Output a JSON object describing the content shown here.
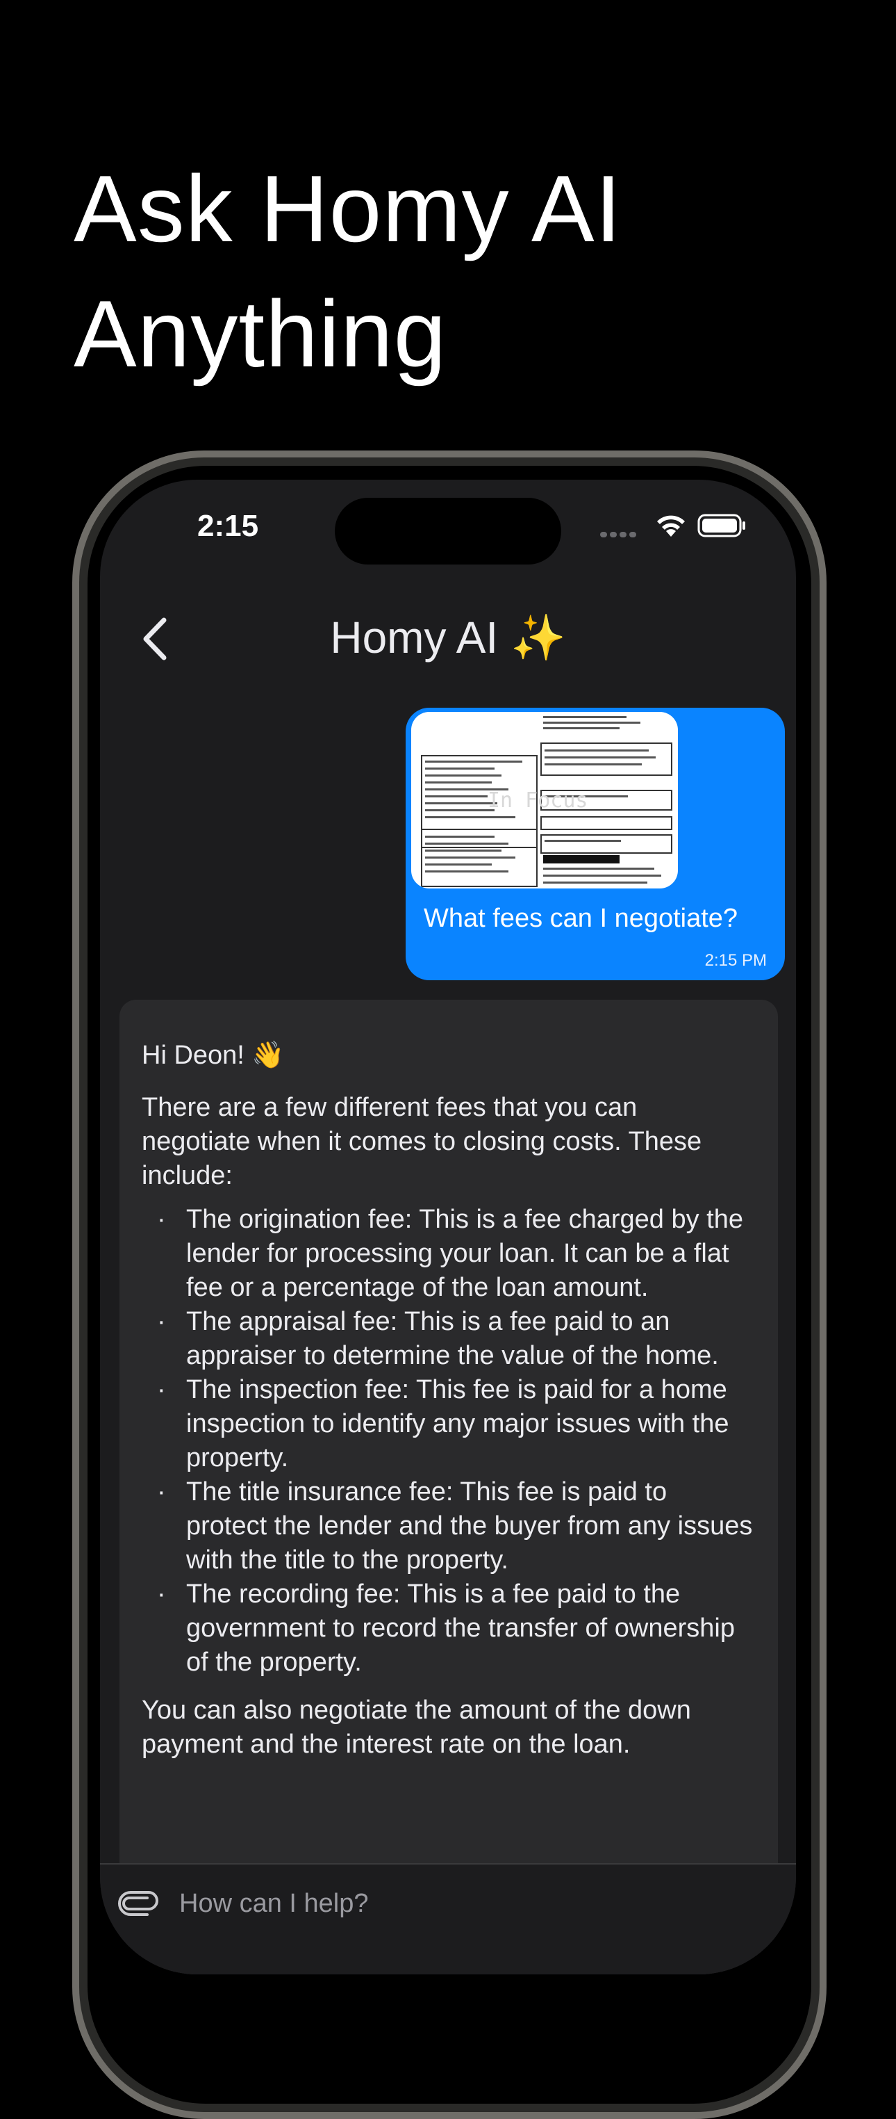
{
  "headline": {
    "line1": "Ask Homy AI",
    "line2": "Anything"
  },
  "status_bar": {
    "time": "2:15"
  },
  "nav": {
    "title": "Homy AI ✨"
  },
  "user_message": {
    "text": "What fees can I negotiate?",
    "time": "2:15 PM",
    "attachment_watermark": "In Focus"
  },
  "reply": {
    "greeting": "Hi Deon! 👋",
    "intro": "There are a few different fees that you can negotiate when it comes to closing costs. These include:",
    "items": [
      "The origination fee: This is a fee charged by the lender for processing your loan. It can be a flat fee or a percentage of the loan amount.",
      "The appraisal fee: This is a fee paid to an appraiser to determine the value of the home.",
      "The inspection fee: This fee is paid for a home inspection to identify any major issues with the property.",
      "The title insurance fee: This fee is paid to protect the lender and the buyer from any issues with the title to the property.",
      "The recording fee: This is a fee paid to the government to record the transfer of ownership of the property."
    ],
    "closing": "You can also negotiate the amount of the down payment and the interest rate on the loan."
  },
  "composer": {
    "placeholder": "How can I help?"
  },
  "colors": {
    "bubble": "#0a84ff",
    "background": "#000000",
    "screen": "#1c1c1e",
    "card": "#2a2a2c"
  },
  "icons": [
    "back-chevron-icon",
    "wifi-icon",
    "battery-icon",
    "paperclip-icon"
  ]
}
